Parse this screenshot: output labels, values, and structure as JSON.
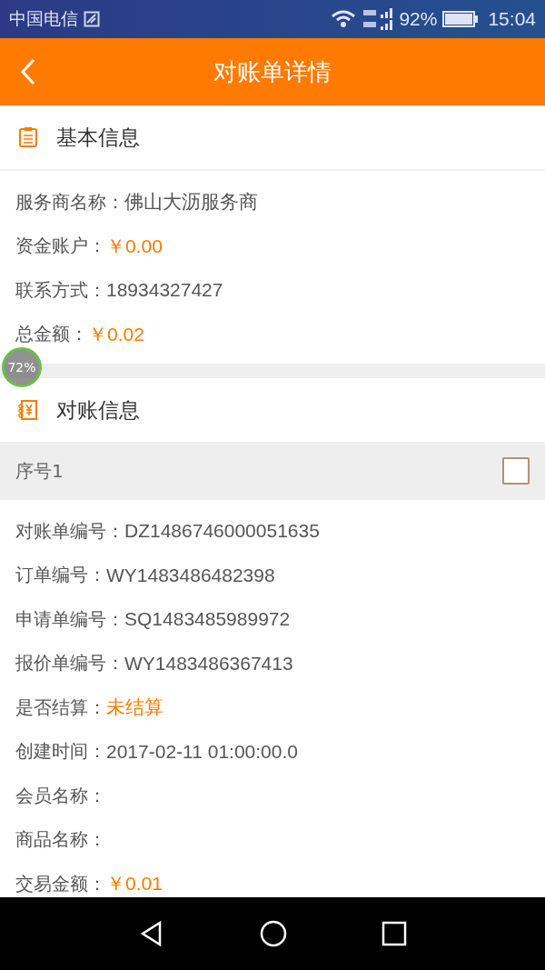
{
  "status_bar": {
    "carrier": "中国电信",
    "battery": "92%",
    "time": "15:04"
  },
  "header": {
    "title": "对账单详情"
  },
  "basic_info": {
    "title": "基本信息",
    "fields": [
      {
        "label": "服务商名称：",
        "value": "佛山大沥服务商",
        "kind": "text"
      },
      {
        "label": "资金账户：",
        "value": "￥0.00",
        "kind": "amount"
      },
      {
        "label": "联系方式：",
        "value": "18934327427",
        "kind": "text"
      },
      {
        "label": "总金额：",
        "value": "￥0.02",
        "kind": "amount"
      }
    ]
  },
  "floating_badge": {
    "text": "72%"
  },
  "reconciliation": {
    "title": "对账信息",
    "items": [
      {
        "index_label": "序号1",
        "checked": false,
        "fields": [
          {
            "label": "对账单编号：",
            "value": "DZ1486746000051635",
            "kind": "text"
          },
          {
            "label": "订单编号：",
            "value": "WY1483486482398",
            "kind": "text"
          },
          {
            "label": "申请单编号：",
            "value": "SQ1483485989972",
            "kind": "text"
          },
          {
            "label": "报价单编号：",
            "value": "WY1483486367413",
            "kind": "text"
          },
          {
            "label": "是否结算：",
            "value": "未结算",
            "kind": "amount"
          },
          {
            "label": "创建时间：",
            "value": "2017-02-11 01:00:00.0",
            "kind": "text"
          },
          {
            "label": "会员名称："
          },
          {
            "label": "商品名称："
          },
          {
            "label": "交易金额：",
            "value": "￥0.01",
            "kind": "amount"
          }
        ]
      }
    ]
  }
}
